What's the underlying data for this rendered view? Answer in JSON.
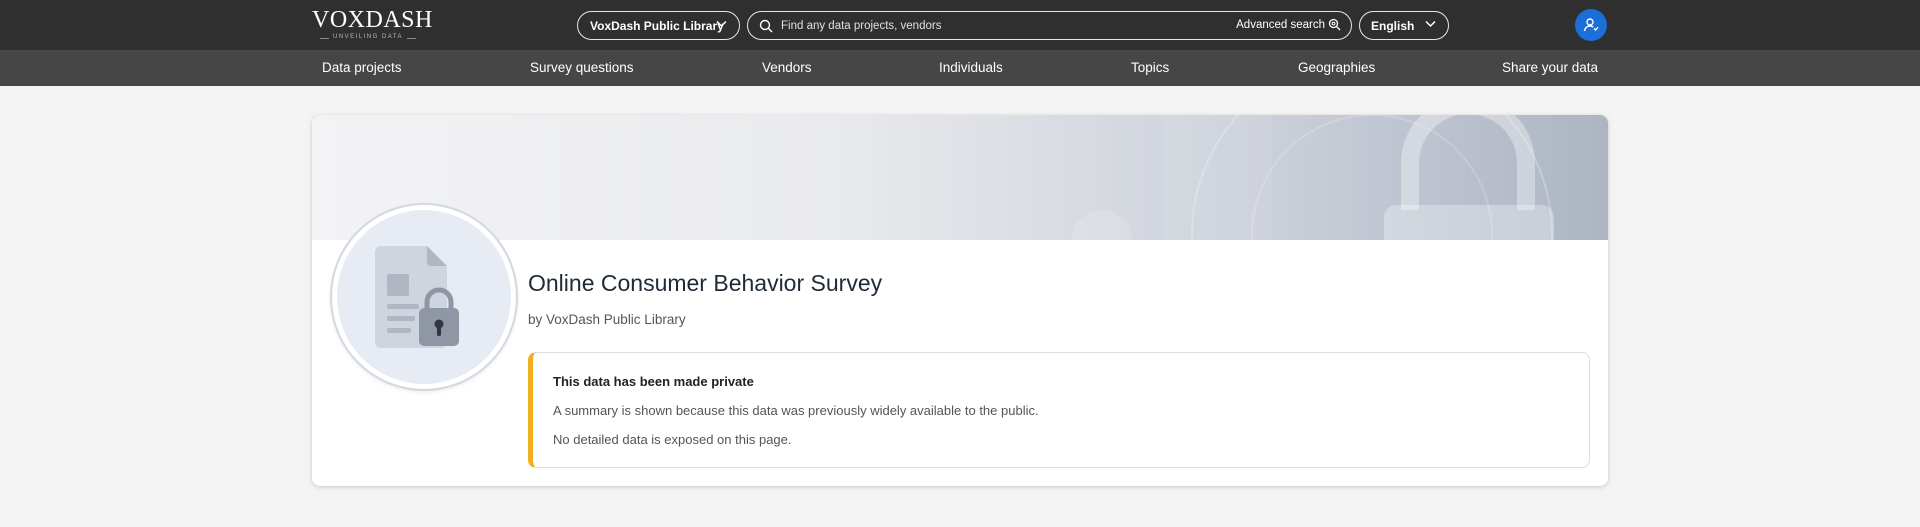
{
  "brand": {
    "name": "VOXDASH",
    "tagline": "UNVEILING DATA"
  },
  "header": {
    "library_select": "VoxDash Public Library",
    "search": {
      "placeholder": "Find any data projects, vendors",
      "advanced_label": "Advanced search"
    },
    "language_select": "English"
  },
  "icons": {
    "search": "search-icon",
    "chevron": "chevron-down-icon",
    "advanced": "settings-search-icon",
    "user": "user-icon",
    "document_lock": "document-lock-icon"
  },
  "nav": {
    "items": [
      {
        "label": "Data projects"
      },
      {
        "label": "Survey questions"
      },
      {
        "label": "Vendors"
      },
      {
        "label": "Individuals"
      },
      {
        "label": "Topics"
      },
      {
        "label": "Geographies"
      },
      {
        "label": "Share your data"
      }
    ]
  },
  "project": {
    "title": "Online Consumer Behavior Survey",
    "byline": "by VoxDash Public Library"
  },
  "notice": {
    "title": "This data has been made private",
    "line1": "A summary is shown because this data was previously widely available to the public.",
    "line2": "No detailed data is exposed on this page."
  },
  "colors": {
    "topbar": "#2f2f2f",
    "navbar": "#464646",
    "accent_user": "#1a6fd8",
    "notice_border": "#f2b01e"
  }
}
